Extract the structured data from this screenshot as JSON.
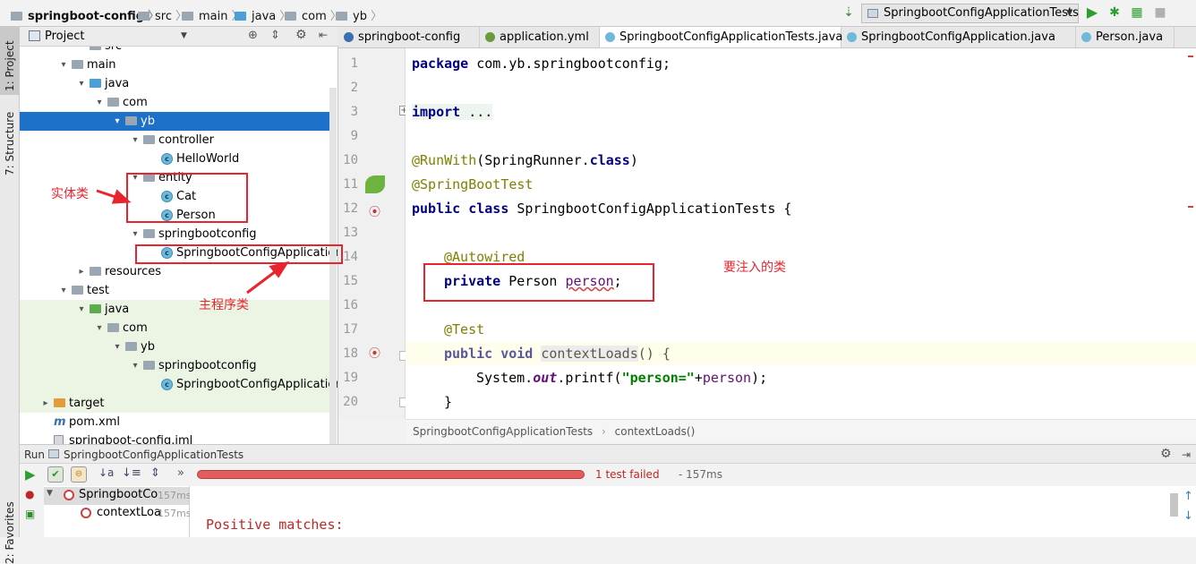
{
  "navbar": {
    "breadcrumbs": [
      "springboot-config",
      "src",
      "main",
      "java",
      "com",
      "yb"
    ],
    "run_config": "SpringbootConfigApplicationTests"
  },
  "left_strip": {
    "tabs": [
      "1: Project",
      "7: Structure",
      "2: Favorites"
    ]
  },
  "project": {
    "title": "Project",
    "tree": [
      {
        "label": "src",
        "depth": 4,
        "kind": "folder",
        "arrow": ""
      },
      {
        "label": "main",
        "depth": 3,
        "kind": "folder",
        "arrow": "open"
      },
      {
        "label": "java",
        "depth": 4,
        "kind": "folder-blue",
        "arrow": "open"
      },
      {
        "label": "com",
        "depth": 5,
        "kind": "folder",
        "arrow": "open"
      },
      {
        "label": "yb",
        "depth": 6,
        "kind": "folder",
        "arrow": "open",
        "selected": true
      },
      {
        "label": "controller",
        "depth": 7,
        "kind": "folder",
        "arrow": "open"
      },
      {
        "label": "HelloWorld",
        "depth": 8,
        "kind": "class",
        "arrow": ""
      },
      {
        "label": "entity",
        "depth": 7,
        "kind": "folder",
        "arrow": "open"
      },
      {
        "label": "Cat",
        "depth": 8,
        "kind": "class",
        "arrow": ""
      },
      {
        "label": "Person",
        "depth": 8,
        "kind": "class",
        "arrow": ""
      },
      {
        "label": "springbootconfig",
        "depth": 7,
        "kind": "folder",
        "arrow": "open"
      },
      {
        "label": "SpringbootConfigApplication",
        "depth": 8,
        "kind": "class",
        "arrow": ""
      },
      {
        "label": "resources",
        "depth": 4,
        "kind": "folder",
        "arrow": "closed"
      },
      {
        "label": "test",
        "depth": 3,
        "kind": "folder",
        "arrow": "open"
      },
      {
        "label": "java",
        "depth": 4,
        "kind": "folder-green",
        "arrow": "open",
        "test": true
      },
      {
        "label": "com",
        "depth": 5,
        "kind": "folder",
        "arrow": "open",
        "test": true
      },
      {
        "label": "yb",
        "depth": 6,
        "kind": "folder",
        "arrow": "open",
        "test": true
      },
      {
        "label": "springbootconfig",
        "depth": 7,
        "kind": "folder",
        "arrow": "open",
        "test": true
      },
      {
        "label": "SpringbootConfigApplicationT",
        "depth": 8,
        "kind": "class",
        "arrow": "",
        "test": true
      },
      {
        "label": "target",
        "depth": 2,
        "kind": "folder-orange",
        "arrow": "closed",
        "test": true
      },
      {
        "label": "pom.xml",
        "depth": 2,
        "kind": "maven",
        "arrow": ""
      },
      {
        "label": "springboot-config.iml",
        "depth": 2,
        "kind": "file",
        "arrow": ""
      }
    ]
  },
  "editor": {
    "tabs": [
      {
        "label": "springboot-config",
        "icon": "maven"
      },
      {
        "label": "application.yml",
        "icon": "yml"
      },
      {
        "label": "SpringbootConfigApplicationTests.java",
        "icon": "class",
        "active": true,
        "close": "×"
      },
      {
        "label": "SpringbootConfigApplication.java",
        "icon": "class"
      },
      {
        "label": "Person.java",
        "icon": "class"
      }
    ],
    "line_numbers": [
      "1",
      "2",
      "3",
      "9",
      "10",
      "11",
      "12",
      "13",
      "14",
      "15",
      "16",
      "17",
      "18",
      "19",
      "20"
    ],
    "code": {
      "l1_kw": "package",
      "l1_rest": " com.yb.springbootconfig;",
      "l3_kw": "import",
      "l3_rest": " ...",
      "l10_an": "@RunWith",
      "l10_a": "(SpringRunner.",
      "l10_kw": "class",
      "l10_b": ")",
      "l11_an": "@SpringBootTest",
      "l12_kw1": "public",
      "l12_kw2": "class",
      "l12_rest": " SpringbootConfigApplicationTests {",
      "l14_an": "@Autowired",
      "l15_kw": "private",
      "l15_type": " Person ",
      "l15_field": "person",
      "l15_end": ";",
      "l17_an": "@Test",
      "l18_kw1": "public",
      "l18_kw2": "void",
      "l18_method": "contextLoads",
      "l18_rest": "() {",
      "l19_a": "System.",
      "l19_out": "out",
      "l19_b": ".printf(",
      "l19_str": "\"person=\"",
      "l19_c": "+",
      "l19_field": "person",
      "l19_d": ");",
      "l20": "}"
    },
    "crumbs": [
      "SpringbootConfigApplicationTests",
      "contextLoads()"
    ]
  },
  "run": {
    "header_label": "Run",
    "header_config": "SpringbootConfigApplicationTests",
    "status": "1 test failed",
    "duration": "- 157ms",
    "tree": [
      {
        "label": "SpringbootCo",
        "time": "157ms"
      },
      {
        "label": "contextLoa",
        "time": "157ms"
      }
    ],
    "output_line": "Positive matches:"
  },
  "annotations": {
    "entity_note": "实体类",
    "main_note": "主程序类",
    "inject_note": "要注入的类"
  },
  "colors": {
    "selection": "#1d71c9",
    "annotation_red": "#e8242e",
    "test_green_bg": "#ecf5e4",
    "keyword": "#000080",
    "annotation": "#808000"
  }
}
